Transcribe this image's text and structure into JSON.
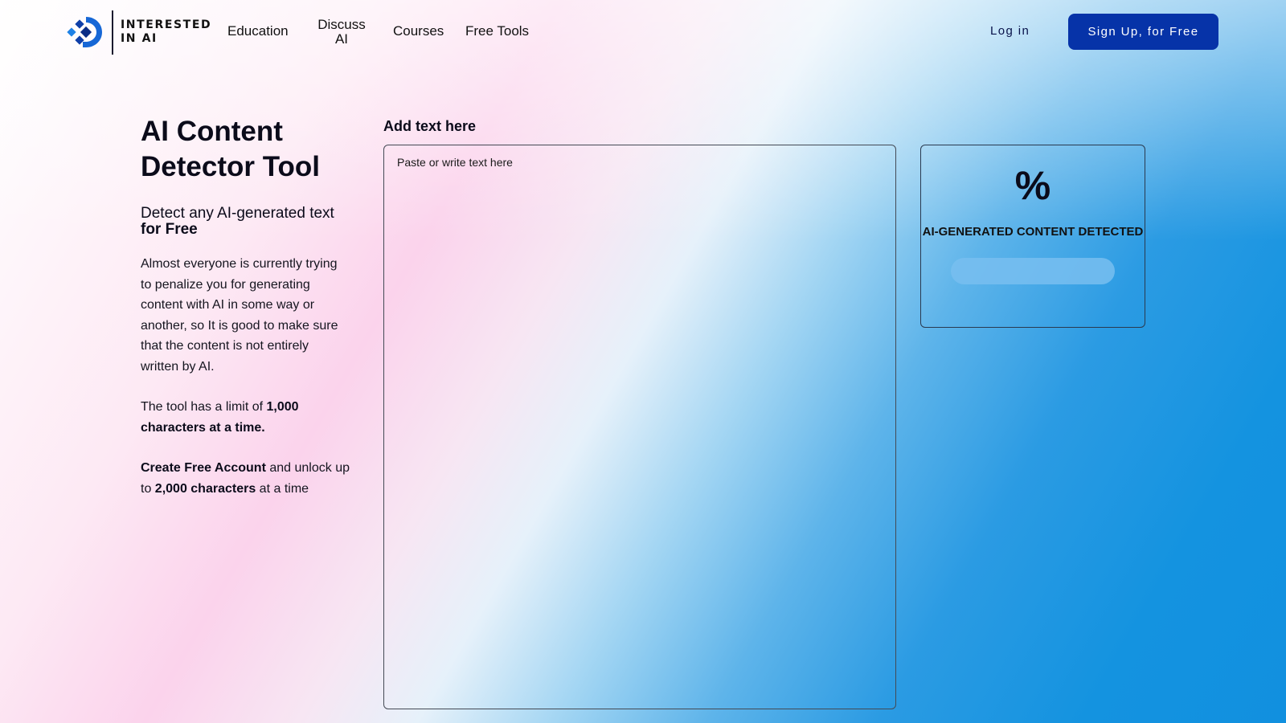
{
  "header": {
    "logo_text": "INTERESTED IN AI",
    "nav": [
      {
        "label": "Education"
      },
      {
        "label": "Discuss AI"
      },
      {
        "label": "Courses"
      },
      {
        "label": "Free Tools"
      }
    ],
    "login_label": "Log in",
    "signup_label": "Sign Up, for Free"
  },
  "hero": {
    "title": "AI Content Detector Tool",
    "subtitle_prefix": "Detect any AI-generated text ",
    "subtitle_bold": "for Free",
    "intro": "Almost everyone is currently trying to penalize you for generating content with AI in some way or another, so It is good to make sure that the content is not entirely written by AI.",
    "limit_prefix": "The tool has a limit of ",
    "limit_bold": "1,000 characters at a time.",
    "unlock_bold_1": "Create Free Account",
    "unlock_mid": " and unlock up to ",
    "unlock_bold_2": "2,000 characters",
    "unlock_suffix": " at a time"
  },
  "editor": {
    "label": "Add text here",
    "placeholder": "Paste or write text here",
    "value": ""
  },
  "result": {
    "percent_text": "%",
    "label": "AI-GENERATED CONTENT DETECTED",
    "progress": 0
  },
  "colors": {
    "signup_bg": "#0633a8",
    "progress_track": "#78bef0",
    "text_dark": "#0b0b1a"
  },
  "icons": {
    "logo": "interested-in-ai-logo-icon"
  }
}
